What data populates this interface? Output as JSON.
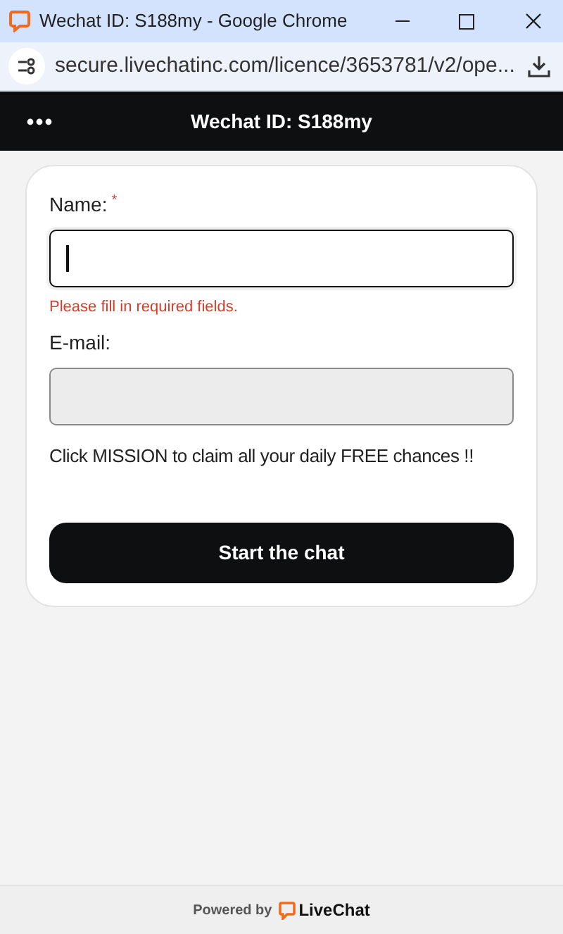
{
  "window": {
    "title": "Wechat ID: S188my - Google Chrome"
  },
  "address_bar": {
    "url": "secure.livechatinc.com/licence/3653781/v2/ope..."
  },
  "header": {
    "title": "Wechat ID: S188my"
  },
  "form": {
    "fields": [
      {
        "label": "Name:",
        "required_mark": "*",
        "focused": true,
        "disabled": false,
        "error": "Please fill in required fields."
      },
      {
        "label": "E-mail:",
        "focused": false,
        "disabled": true
      }
    ],
    "message": "Click MISSION to claim all your daily FREE chances !!",
    "submit": "Start the chat"
  },
  "footer": {
    "powered_by": "Powered by",
    "brand": "LiveChat"
  }
}
